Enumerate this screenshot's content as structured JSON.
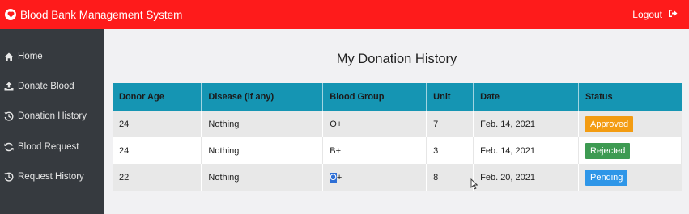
{
  "header": {
    "brand": "Blood Bank Management System",
    "logout": "Logout",
    "bg_color": "#fe1b1b"
  },
  "sidebar": {
    "items": [
      {
        "label": "Home",
        "icon": "home-icon"
      },
      {
        "label": "Donate Blood",
        "icon": "upload-icon"
      },
      {
        "label": "Donation History",
        "icon": "history-icon"
      },
      {
        "label": "Blood Request",
        "icon": "refresh-icon"
      },
      {
        "label": "Request History",
        "icon": "history-icon"
      }
    ]
  },
  "main": {
    "title": "My Donation History",
    "columns": [
      "Donor Age",
      "Disease (if any)",
      "Blood Group",
      "Unit",
      "Date",
      "Status"
    ],
    "rows": [
      {
        "age": "24",
        "disease": "Nothing",
        "group": "O+",
        "unit": "7",
        "date": "Feb. 14, 2021",
        "status": "Approved",
        "status_color": "#f39c12"
      },
      {
        "age": "24",
        "disease": "Nothing",
        "group": "B+",
        "unit": "3",
        "date": "Feb. 14, 2021",
        "status": "Rejected",
        "status_color": "#3d9a52"
      },
      {
        "age": "22",
        "disease": "Nothing",
        "group": "O+",
        "unit": "8",
        "date": "Feb. 20, 2021",
        "status": "Pending",
        "status_color": "#2e96e8"
      }
    ]
  }
}
